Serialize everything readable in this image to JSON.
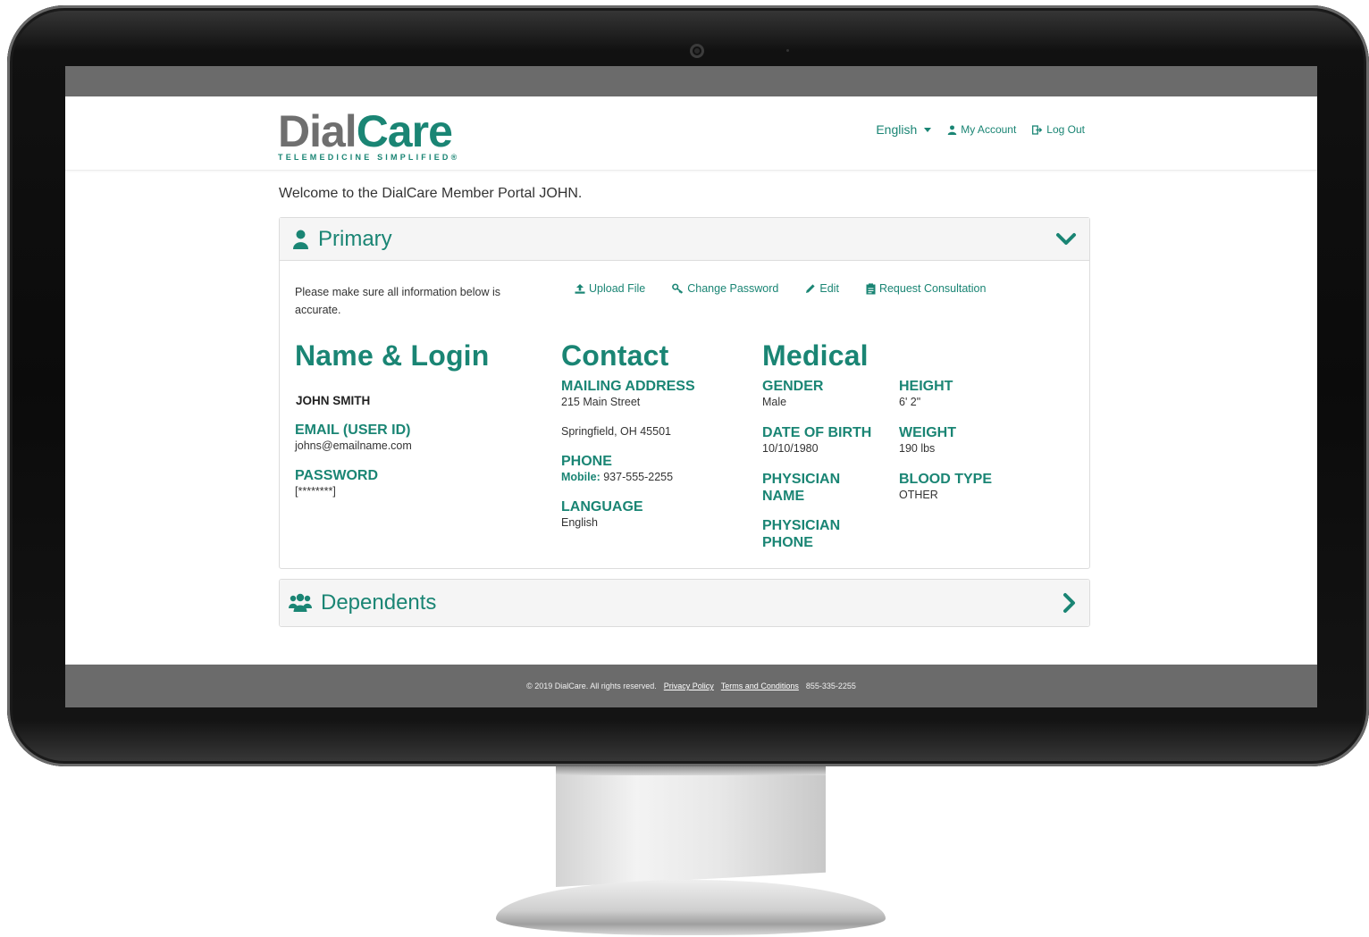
{
  "brand": {
    "name_part1": "Dial",
    "name_part2": "Care",
    "tagline": "TELEMEDICINE SIMPLIFIED®",
    "accent_color": "#1a8574",
    "gray_color": "#6f6f6f"
  },
  "nav": {
    "language": "English",
    "my_account": "My Account",
    "logout": "Log Out"
  },
  "welcome": "Welcome to the DialCare Member Portal JOHN.",
  "primary": {
    "title": "Primary",
    "info": "Please make sure all information below is accurate.",
    "actions": {
      "upload": "Upload File",
      "change_password": "Change Password",
      "edit": "Edit",
      "request": "Request Consultation"
    },
    "name_login": {
      "heading": "Name & Login",
      "name": "JOHN SMITH",
      "email_label": "EMAIL (USER ID)",
      "email": "johns@emailname.com",
      "password_label": "PASSWORD",
      "password": "[********]"
    },
    "contact": {
      "heading": "Contact",
      "mailing_label": "MAILING ADDRESS",
      "street": "215 Main Street",
      "city": "Springfield, OH 45501",
      "phone_label": "PHONE",
      "phone_prefix": "Mobile:",
      "phone": "937-555-2255",
      "language_label": "LANGUAGE",
      "language": "English"
    },
    "medical": {
      "heading": "Medical",
      "gender_label": "GENDER",
      "gender": "Male",
      "height_label": "HEIGHT",
      "height": "6' 2\"",
      "dob_label": "DATE OF BIRTH",
      "dob": "10/10/1980",
      "weight_label": "WEIGHT",
      "weight": "190 lbs",
      "physician_name_label1": "PHYSICIAN",
      "physician_name_label2": "NAME",
      "blood_label": "BLOOD TYPE",
      "blood": "OTHER",
      "physician_phone_label1": "PHYSICIAN",
      "physician_phone_label2": "PHONE"
    }
  },
  "dependents": {
    "title": "Dependents"
  },
  "footer": {
    "copyright": "© 2019 DialCare. All rights reserved.",
    "privacy": "Privacy Policy",
    "terms": "Terms and Conditions",
    "phone": "855-335-2255"
  }
}
